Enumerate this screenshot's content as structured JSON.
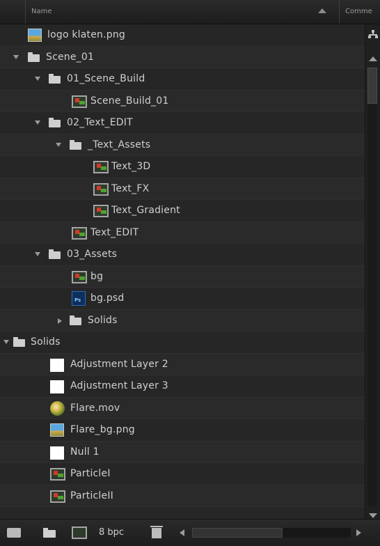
{
  "header": {
    "name_column": "Name",
    "comments_column": "Comme"
  },
  "items": [
    {
      "label": "logo klaten.png",
      "icon": "png-image-icon",
      "type": "png",
      "expanded": null
    },
    {
      "label": "Scene_01",
      "icon": "folder-icon",
      "type": "folder",
      "expanded": true
    },
    {
      "label": "01_Scene_Build",
      "icon": "folder-icon",
      "type": "folder",
      "expanded": true
    },
    {
      "label": "Scene_Build_01",
      "icon": "composition-icon",
      "type": "comp",
      "expanded": null
    },
    {
      "label": "02_Text_EDIT",
      "icon": "folder-icon",
      "type": "folder",
      "expanded": true
    },
    {
      "label": "_Text_Assets",
      "icon": "folder-icon",
      "type": "folder",
      "expanded": true
    },
    {
      "label": "Text_3D",
      "icon": "composition-icon",
      "type": "comp",
      "expanded": null
    },
    {
      "label": "Text_FX",
      "icon": "composition-icon",
      "type": "comp",
      "expanded": null
    },
    {
      "label": "Text_Gradient",
      "icon": "composition-icon",
      "type": "comp",
      "expanded": null
    },
    {
      "label": "Text_EDIT",
      "icon": "composition-icon",
      "type": "comp",
      "expanded": null
    },
    {
      "label": "03_Assets",
      "icon": "folder-icon",
      "type": "folder",
      "expanded": true
    },
    {
      "label": "bg",
      "icon": "composition-icon",
      "type": "comp",
      "expanded": null
    },
    {
      "label": "bg.psd",
      "icon": "photoshop-file-icon",
      "type": "psd",
      "expanded": null
    },
    {
      "label": "Solids",
      "icon": "folder-icon",
      "type": "folder",
      "expanded": false
    },
    {
      "label": "Solids",
      "icon": "folder-icon",
      "type": "folder",
      "expanded": true
    },
    {
      "label": "Adjustment Layer 2",
      "icon": "solid-layer-icon",
      "type": "solid",
      "expanded": null
    },
    {
      "label": "Adjustment Layer 3",
      "icon": "solid-layer-icon",
      "type": "solid",
      "expanded": null
    },
    {
      "label": "Flare.mov",
      "icon": "quicktime-movie-icon",
      "type": "mov",
      "expanded": null
    },
    {
      "label": "Flare_bg.png",
      "icon": "png-image-icon",
      "type": "png",
      "expanded": null
    },
    {
      "label": "Null 1",
      "icon": "solid-layer-icon",
      "type": "solid",
      "expanded": null
    },
    {
      "label": "ParticleI",
      "icon": "composition-icon",
      "type": "comp",
      "expanded": null
    },
    {
      "label": "ParticleII",
      "icon": "composition-icon",
      "type": "comp",
      "expanded": null
    }
  ],
  "footer": {
    "bpc_label": "8 bpc"
  },
  "scrollbar": {
    "vertical_position": 0,
    "horizontal_position": 0
  },
  "colors": {
    "panel_background": "#232323",
    "row_alt_background": "#2a2a2a",
    "text": "#d0d0d0"
  }
}
